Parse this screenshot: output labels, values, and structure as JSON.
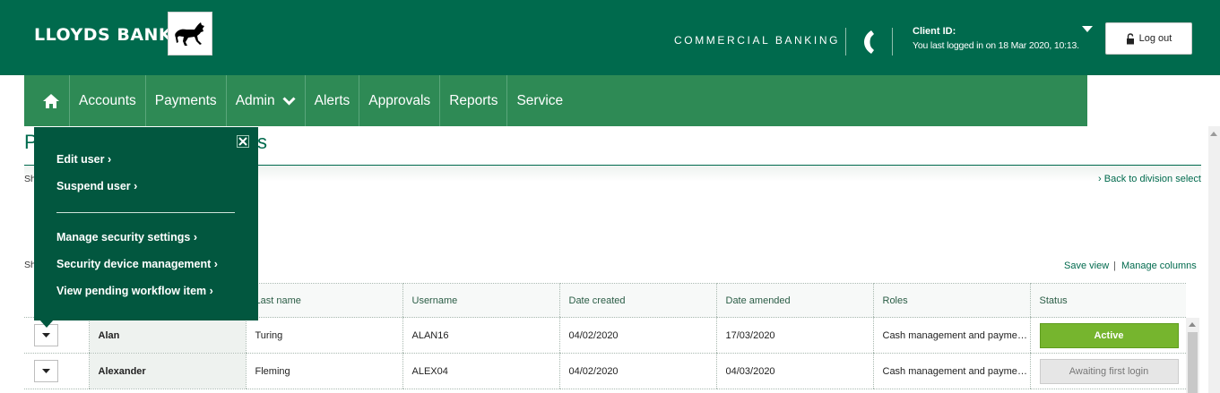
{
  "header": {
    "brand": "LLOYDS BANK",
    "section": "COMMERCIAL BANKING",
    "client_id_label": "Client ID:",
    "last_login": "You last logged in on 18 Mar 2020, 10:13.",
    "logout_label": "Log out"
  },
  "nav": {
    "items": [
      "Accounts",
      "Payments",
      "Admin",
      "Alerts",
      "Approvals",
      "Reports",
      "Service"
    ]
  },
  "page": {
    "title_start": "P",
    "title_end": "s",
    "frag_show_1": "Sh",
    "frag_show_2": "Sh",
    "back_link": "Back to division select",
    "save_view": "Save view",
    "separator": "|",
    "manage_columns": "Manage columns"
  },
  "table": {
    "headers": [
      "Last name",
      "Username",
      "Date created",
      "Date amended",
      "Roles",
      "Status"
    ],
    "rows": [
      {
        "first_name": "Alan",
        "last_name": "Turing",
        "username": "ALAN16",
        "date_created": "04/02/2020",
        "date_amended": "17/03/2020",
        "roles": "Cash management and payments",
        "status": "Active"
      },
      {
        "first_name": "Alexander",
        "last_name": "Fleming",
        "username": "ALEX04",
        "date_created": "04/02/2020",
        "date_amended": "04/03/2020",
        "roles": "Cash management and payments",
        "status": "Awaiting first login"
      }
    ]
  },
  "popover": {
    "items": [
      "Edit user",
      "Suspend user",
      "Manage security settings",
      "Security device management",
      "View pending workflow item"
    ],
    "chevron": "›"
  },
  "colors": {
    "header_green": "#006a4d",
    "nav_green": "#2e8a55",
    "popover_green": "#02573f",
    "active_status": "#76b52e"
  }
}
